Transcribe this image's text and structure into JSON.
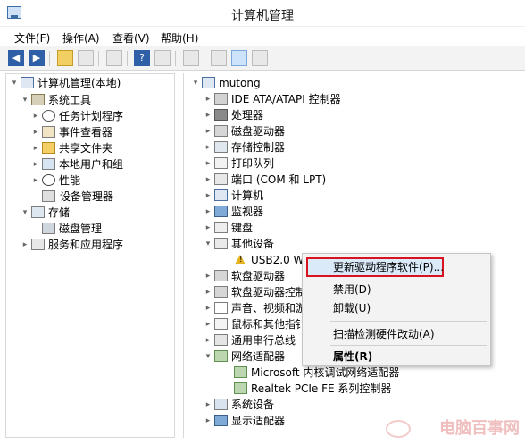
{
  "window": {
    "title": "计算机管理"
  },
  "menu": {
    "file": "文件(F)",
    "action": "操作(A)",
    "view": "查看(V)",
    "help": "帮助(H)"
  },
  "left_tree": {
    "root": "计算机管理(本地)",
    "system_tools": "系统工具",
    "task_scheduler": "任务计划程序",
    "event_viewer": "事件查看器",
    "shared_folders": "共享文件夹",
    "local_users_groups": "本地用户和组",
    "performance": "性能",
    "device_manager": "设备管理器",
    "storage": "存储",
    "disk_management": "磁盘管理",
    "services_apps": "服务和应用程序"
  },
  "device_tree": {
    "computer_name": "mutong",
    "items": [
      "IDE ATA/ATAPI 控制器",
      "处理器",
      "磁盘驱动器",
      "存储控制器",
      "打印队列",
      "端口 (COM 和 LPT)",
      "计算机",
      "监视器",
      "键盘",
      "其他设备",
      "USB2.0 W",
      "软盘驱动器",
      "软盘驱动器控制",
      "声音、视频和游",
      "鼠标和其他指针",
      "通用串行总线",
      "网络适配器",
      "Microsoft 内核调试网络适配器",
      "Realtek PCIe FE 系列控制器",
      "系统设备",
      "显示适配器"
    ]
  },
  "context_menu": {
    "update_driver": "更新驱动程序软件(P)...",
    "disable": "禁用(D)",
    "uninstall": "卸载(U)",
    "scan": "扫描检测硬件改动(A)",
    "properties": "属性(R)"
  },
  "watermark": {
    "text": "电脑百事网"
  }
}
